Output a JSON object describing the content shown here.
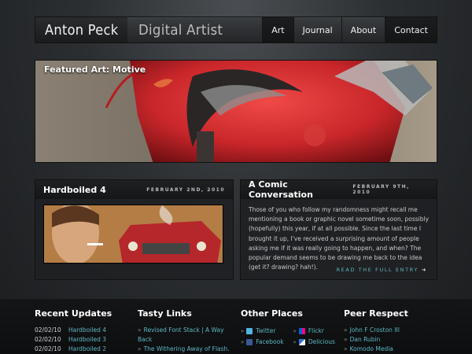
{
  "header": {
    "brand": "Anton Peck",
    "tagline": "Digital Artist",
    "nav": [
      "Art",
      "Journal",
      "About",
      "Contact"
    ]
  },
  "featured": {
    "label": "Featured Art: Motive"
  },
  "posts": [
    {
      "title": "Hardboiled 4",
      "date": "FEBRUARY 2ND, 2010"
    },
    {
      "title": "A Comic Conversation",
      "date": "FEBRUARY 9TH, 2010",
      "body": "Those of you who follow my randomness might recall me mentioning a book or graphic novel sometime soon, possibly (hopefully) this year, if at all possible. Since the last time I brought it up, I've received a surprising amount of people asking me if it was really going to happen, and when? The popular demand seems to be drawing me back to the idea (get it? drawing? hah!).",
      "read_more": "READ THE FULL ENTRY"
    }
  ],
  "footer": {
    "recent": {
      "title": "Recent Updates",
      "items": [
        {
          "date": "02/02/10",
          "label": "Hardboiled 4"
        },
        {
          "date": "02/02/10",
          "label": "Hardboiled 3"
        },
        {
          "date": "02/02/10",
          "label": "Hardboiled 2"
        }
      ]
    },
    "tasty": {
      "title": "Tasty Links",
      "items": [
        "Revised Font Stack | A Way Back",
        "The Withering Away of Flash."
      ]
    },
    "places": {
      "title": "Other Places",
      "col1": [
        "Twitter",
        "Facebook"
      ],
      "col2": [
        "Flickr",
        "Delicious"
      ]
    },
    "peer": {
      "title": "Peer Respect",
      "items": [
        "John F Croston III",
        "Dan Rubin",
        "Komodo Media"
      ]
    }
  },
  "colors": {
    "accent": "#5fb6c4",
    "featured_red": "#c8262a"
  }
}
